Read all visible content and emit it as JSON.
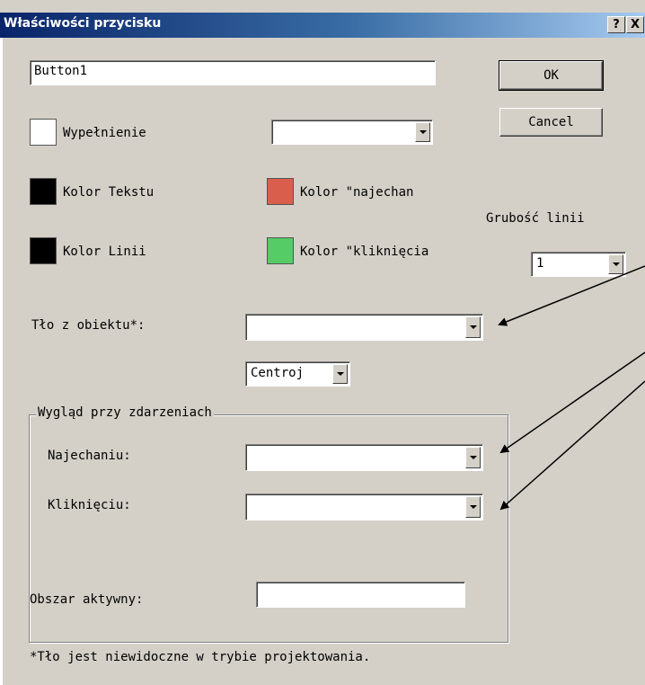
{
  "window": {
    "title": "Właściwości przycisku",
    "help_button": "?",
    "close_button": "X"
  },
  "name_field": {
    "value": "Button1"
  },
  "buttons": {
    "ok": "OK",
    "cancel": "Cancel"
  },
  "fill": {
    "label": "Wypełnienie",
    "swatch_color": "#ffffff",
    "select_value": ""
  },
  "colors": {
    "text_label": "Kolor Tekstu",
    "text_color": "#000000",
    "line_label": "Kolor Linii",
    "line_color": "#000000",
    "hover_label": "Kolor \"najechan",
    "hover_color": "#d95f4c",
    "click_label": "Kolor \"kliknięcia",
    "click_color": "#55cc66"
  },
  "line_width": {
    "label": "Grubość linii",
    "value": "1"
  },
  "background_object": {
    "label": "Tło z obiektu*:",
    "value": ""
  },
  "alignment": {
    "value": "Centroj"
  },
  "events_group": {
    "legend": "Wygląd przy zdarzeniach",
    "hover_label": "Najechaniu:",
    "hover_value": "",
    "click_label": "Kliknięciu:",
    "click_value": ""
  },
  "active_area": {
    "label": "Obszar aktywny:",
    "value": ""
  },
  "footnote": "*Tło jest niewidoczne w trybie projektowania."
}
